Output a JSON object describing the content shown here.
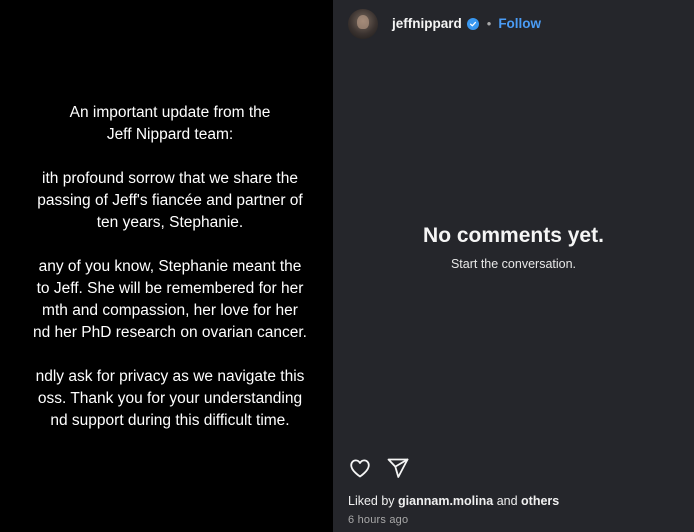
{
  "post": {
    "paragraphs": [
      [
        "An important update from the",
        "Jeff Nippard team:"
      ],
      [
        "ith profound sorrow that we share the",
        "passing of Jeff's fiancée and partner of",
        "ten years, Stephanie."
      ],
      [
        "any of you know, Stephanie meant the",
        "to Jeff. She will be remembered for her",
        "mth and compassion, her love for her",
        "nd her PhD research on ovarian cancer."
      ],
      [
        "ndly ask for privacy as we navigate this",
        "oss. Thank you for your understanding",
        "nd support during this difficult time."
      ]
    ]
  },
  "header": {
    "username": "jeffnippard",
    "separator": "•",
    "follow_label": "Follow"
  },
  "comments": {
    "empty_title": "No comments yet.",
    "empty_subtitle": "Start the conversation."
  },
  "actions": {
    "like_icon": "heart-icon",
    "share_icon": "share-icon"
  },
  "likes": {
    "prefix": "Liked by",
    "user": "giannam.molina",
    "conjunction": "and",
    "others": "others"
  },
  "timestamp": "6 hours ago",
  "colors": {
    "panel_bg": "#25262b",
    "media_bg": "#000000",
    "follow": "#4a9cf5",
    "verified": "#3897f0",
    "muted": "#a8a8a8"
  }
}
